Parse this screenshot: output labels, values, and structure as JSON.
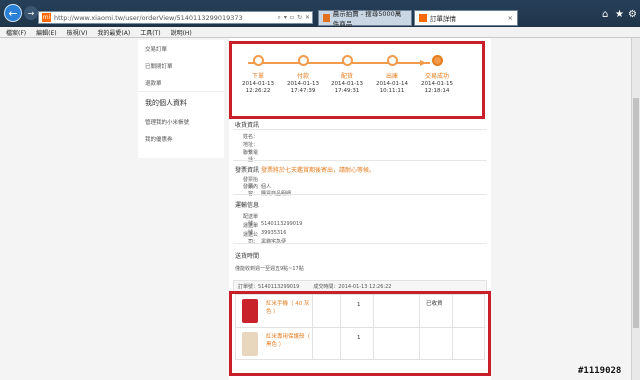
{
  "browser": {
    "back_icon": "back-arrow-icon",
    "url": "http://www.xiaomi.tw/user/orderView/5140113299019373",
    "favicon": "mi",
    "tabs": [
      {
        "label": "晨示拍賣 - 搜尋5000萬件商品"
      },
      {
        "label": "訂單詳情"
      }
    ],
    "tab_close": "×",
    "menu": [
      "檔案(F)",
      "編輯(E)",
      "檢視(V)",
      "我的最愛(A)",
      "工具(T)",
      "說明(H)"
    ]
  },
  "sidebar": {
    "items_top": [
      "交易訂單",
      "已關閉訂單",
      "退款單"
    ],
    "personal_heading": "我的個人資料",
    "items_bottom": [
      "管理我的小米帳號",
      "我的優惠券"
    ]
  },
  "timeline": {
    "steps": [
      {
        "label": "下單",
        "date": "2014-01-13",
        "time": "12:26:22"
      },
      {
        "label": "付款",
        "date": "2014-01-13",
        "time": "17:47:39"
      },
      {
        "label": "配貨",
        "date": "2014-01-13",
        "time": "17:49:31"
      },
      {
        "label": "出庫",
        "date": "2014-01-14",
        "time": "10:11:11"
      },
      {
        "label": "交易成功",
        "date": "2014-01-15",
        "time": "12:18:14"
      }
    ]
  },
  "receiver": {
    "title": "收貨資訊",
    "name_label": "姓名：",
    "address_label": "地址：",
    "phone_label": "聯繫電話："
  },
  "invoice": {
    "title": "發票資訊",
    "note": "發票將於七天鑑賞期後寄出，請耐心等候。",
    "type_label": "發票抬頭：",
    "type_value": "個人",
    "content_label": "發票內容：",
    "content_value": "購買商品明細"
  },
  "delivery": {
    "title": "運輸信息",
    "rows": [
      {
        "label": "配送單號：",
        "value": "5140113299019"
      },
      {
        "label": "運送單號：",
        "value": "39935316"
      },
      {
        "label": "運送公司：",
        "value": "黑貓宅急便"
      }
    ]
  },
  "products": {
    "title": "送貨時間",
    "delivery_note": "僅能收到週一至週五9點~17點",
    "order_no_label": "訂單號：5140113299019",
    "order_time_label": "成交時間：2014-01-13 12:26:22",
    "items": [
      {
        "name": "紅米手機（ 40 灰色 ）",
        "qty": "1",
        "status": "已收貨",
        "thumb_icon": "red-phone-icon"
      },
      {
        "name": "紅米專用保護殼（ 黑色 ）",
        "qty": "1",
        "status": "",
        "thumb_icon": "phone-case-icon"
      }
    ]
  },
  "watermark": "#1119028",
  "colors": {
    "accent": "#e47d20",
    "highlight_box": "#c8202a"
  }
}
